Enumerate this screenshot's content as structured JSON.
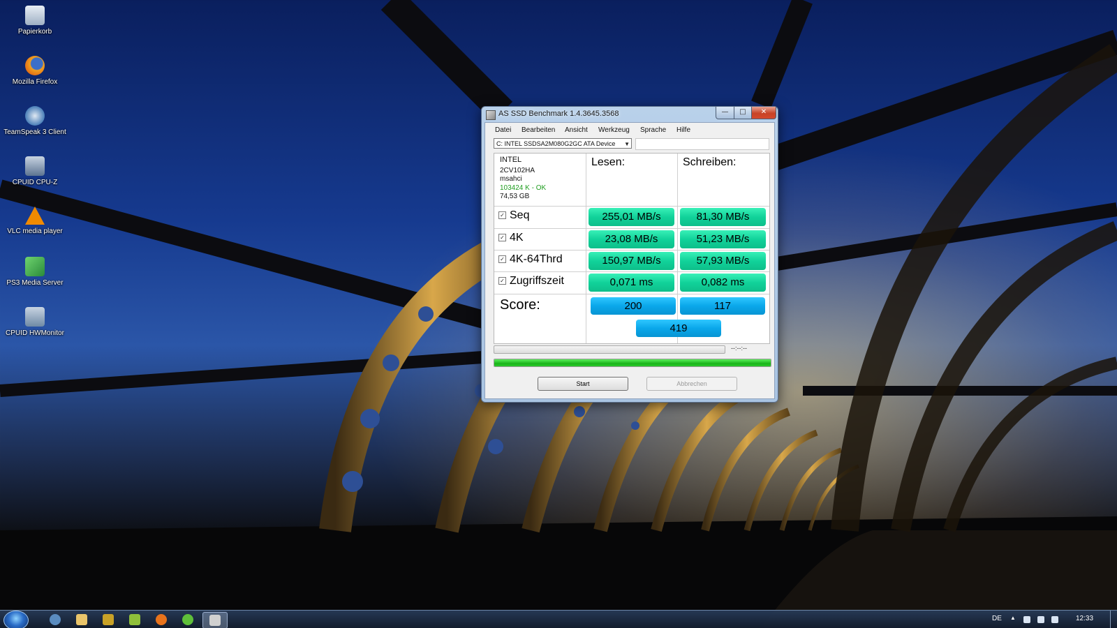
{
  "desktop": {
    "icons": [
      {
        "label": "Papierkorb",
        "icon": "recycle-bin-icon",
        "color": "#cfd8e3"
      },
      {
        "label": "Mozilla Firefox",
        "icon": "firefox-icon",
        "color": "#e8731c"
      },
      {
        "label": "TeamSpeak 3 Client",
        "icon": "teamspeak-icon",
        "color": "#4a7fb8"
      },
      {
        "label": "CPUID CPU-Z",
        "icon": "cpuz-icon",
        "color": "#7c8fa8"
      },
      {
        "label": "VLC media player",
        "icon": "vlc-icon",
        "color": "#f08a00"
      },
      {
        "label": "PS3 Media Server",
        "icon": "ps3-media-server-icon",
        "color": "#3aa04a"
      },
      {
        "label": "CPUID HWMonitor",
        "icon": "hwmonitor-icon",
        "color": "#6f8aa5"
      }
    ]
  },
  "window": {
    "title": "AS SSD Benchmark 1.4.3645.3568",
    "menu": [
      "Datei",
      "Bearbeiten",
      "Ansicht",
      "Werkzeug",
      "Sprache",
      "Hilfe"
    ],
    "drive": "C: INTEL SSDSA2M080G2GC ATA Device",
    "info": {
      "brand": "INTEL",
      "firmware": "2CV102HA",
      "driver": "msahci",
      "alignment": "103424 K - OK",
      "size": "74,53 GB"
    },
    "headers": {
      "read": "Lesen:",
      "write": "Schreiben:"
    },
    "rows": [
      {
        "label": "Seq",
        "checked": true,
        "read": "255,01 MB/s",
        "write": "81,30 MB/s"
      },
      {
        "label": "4K",
        "checked": true,
        "read": "23,08 MB/s",
        "write": "51,23 MB/s"
      },
      {
        "label": "4K-64Thrd",
        "checked": true,
        "read": "150,97 MB/s",
        "write": "57,93 MB/s"
      },
      {
        "label": "Zugriffszeit",
        "checked": true,
        "read": "0,071 ms",
        "write": "0,082 ms"
      }
    ],
    "score": {
      "label": "Score:",
      "read": "200",
      "write": "117",
      "total": "419"
    },
    "time_display": "--:--:--",
    "progress_fraction": 1.0,
    "buttons": {
      "start": "Start",
      "cancel": "Abbrechen"
    },
    "colors": {
      "value": "#11d29a",
      "score": "#0aa7ea",
      "progress": "#19b419"
    }
  },
  "taskbar": {
    "apps": [
      {
        "icon": "teamspeak-taskbar-icon",
        "color": "#5a8cc0"
      },
      {
        "icon": "explorer-icon",
        "color": "#e9c46a"
      },
      {
        "icon": "winamp-icon",
        "color": "#c9a227"
      },
      {
        "icon": "utility-icon",
        "color": "#8fbf3a"
      },
      {
        "icon": "firefox-taskbar-icon",
        "color": "#e8731c"
      },
      {
        "icon": "utorrent-icon",
        "color": "#5fbf3a"
      },
      {
        "icon": "as-ssd-taskbar-icon",
        "color": "#d0d0d0"
      }
    ],
    "language": "DE",
    "clock": "12:33"
  }
}
